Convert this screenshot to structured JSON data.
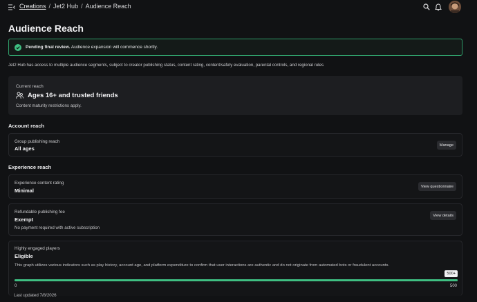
{
  "breadcrumb": {
    "root": "Creations",
    "middle": "Jet2 Hub",
    "current": "Audience Reach"
  },
  "page_title": "Audience Reach",
  "alert": {
    "strong": "Pending final review.",
    "text": "Audience expansion will commence shortly."
  },
  "intro": "Jet2 Hub has access to multiple audience segments, subject to creator publishing status, content rating, content/safety evaluation, parental controls, and regional rules",
  "current_reach": {
    "label": "Current reach",
    "value": "Ages 16+ and trusted friends",
    "note": "Content maturity restrictions apply."
  },
  "sections": {
    "account": "Account reach",
    "experience": "Experience reach"
  },
  "group_publishing": {
    "label": "Group publishing reach",
    "value": "All ages",
    "button": "Manage"
  },
  "content_rating": {
    "label": "Experience content rating",
    "value": "Minimal",
    "button": "View questionnaire"
  },
  "publishing_fee": {
    "label": "Refundable publishing fee",
    "value": "Exempt",
    "note": "No payment required with active subscription",
    "button": "View details"
  },
  "engaged_players": {
    "label": "Highly engaged players",
    "value": "Eligible",
    "note": "This graph utilizes various indicators such as play history, account age, and platform expenditure to confirm that user interactions are authentic and do not originate from automated bots or fraudulent accounts.",
    "min_label": "0",
    "max_label": "500",
    "badge": "500+",
    "progress_percent": 100
  },
  "last_updated": "Last updated 7/8/2026",
  "colors": {
    "accent": "#3fbf82",
    "background": "#111214",
    "card": "#1d1e21"
  }
}
